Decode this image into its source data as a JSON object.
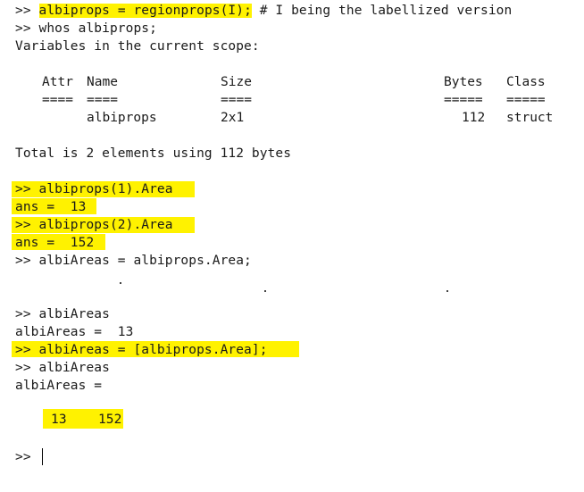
{
  "console": {
    "prompt": ">>",
    "lines": {
      "l1_cmd": "albiprops = regionprops(I);",
      "l1_comment": " # I being the labellized version",
      "l2": ">> whos albiprops;",
      "l3": "Variables in the current scope:",
      "l_total": "Total is 2 elements using 112 bytes",
      "l_area1_cmd": ">> albiprops(1).Area",
      "l_ans1": "ans =  13",
      "l_area2_cmd": ">> albiprops(2).Area",
      "l_ans2": "ans =  152",
      "l_albi_assign": ">> albiAreas = albiprops.Area;",
      "l_albi_show": ">> albiAreas",
      "l_albi_val": "albiAreas =  13",
      "l_albi_bracket": ">> albiAreas = [albiprops.Area];",
      "l_albi_show2": ">> albiAreas",
      "l_albi_eq": "albiAreas =",
      "l_result": "13    152",
      "l_last_prompt": ">>"
    },
    "whos_table": {
      "headers": [
        "Attr",
        "Name",
        "Size",
        "Bytes",
        "Class"
      ],
      "separators": [
        "====",
        "====",
        "====",
        "=====",
        "====="
      ],
      "rows": [
        {
          "attr": "",
          "name": "albiprops",
          "size": "2x1",
          "bytes": "112",
          "class": "struct"
        }
      ]
    }
  },
  "colors": {
    "highlight": "#fff200",
    "text": "#1a1a1a",
    "background": "#ffffff"
  }
}
